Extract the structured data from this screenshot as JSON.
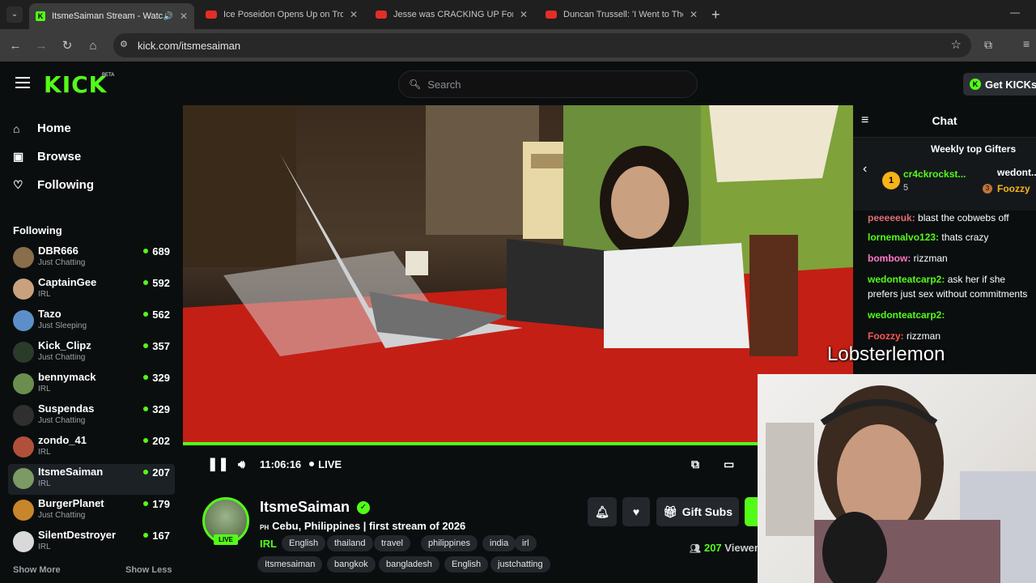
{
  "browser": {
    "tabs": [
      {
        "title": "ItsmeSaiman Stream - Watch",
        "active": true
      },
      {
        "title": "Ice Poseidon Opens Up on Trou",
        "active": false
      },
      {
        "title": "Jesse was CRACKING UP For RA",
        "active": false
      },
      {
        "title": "Duncan Trussell: 'I Went to The",
        "active": false
      }
    ],
    "new_tab": "+",
    "url": "kick.com/itsmesaiman",
    "minimize": "—"
  },
  "header": {
    "logo": "KICK",
    "beta": "BETA",
    "search_placeholder": "Search",
    "get_kicks": "Get KICKs"
  },
  "sidebar": {
    "nav": [
      {
        "label": "Home",
        "icon": "home-icon"
      },
      {
        "label": "Browse",
        "icon": "browse-icon"
      },
      {
        "label": "Following",
        "icon": "heart-icon"
      }
    ],
    "following_heading": "Following",
    "channels": [
      {
        "name": "DBR666",
        "category": "Just Chatting",
        "viewers": "689",
        "color": "#8a6d4a"
      },
      {
        "name": "CaptainGee",
        "category": "IRL",
        "viewers": "592",
        "color": "#c9a27d"
      },
      {
        "name": "Tazo",
        "category": "Just Sleeping",
        "viewers": "562",
        "color": "#5c8fc9"
      },
      {
        "name": "Kick_Clipz",
        "category": "Just Chatting",
        "viewers": "357",
        "color": "#2a3b2a"
      },
      {
        "name": "bennymack",
        "category": "IRL",
        "viewers": "329",
        "color": "#6a8e4f"
      },
      {
        "name": "Suspendas",
        "category": "Just Chatting",
        "viewers": "329",
        "color": "#2f2f2f"
      },
      {
        "name": "zondo_41",
        "category": "IRL",
        "viewers": "202",
        "color": "#b0503a"
      },
      {
        "name": "ItsmeSaiman",
        "category": "IRL",
        "viewers": "207",
        "color": "#7c9a63"
      },
      {
        "name": "BurgerPlanet",
        "category": "Just Chatting",
        "viewers": "179",
        "color": "#c8862a"
      },
      {
        "name": "SilentDestroyer",
        "category": "IRL",
        "viewers": "167",
        "color": "#d9d9d9"
      }
    ],
    "show_more": "Show More",
    "show_less": "Show Less"
  },
  "player": {
    "time": "11:06:16",
    "live": "LIVE"
  },
  "stream": {
    "name": "ItsmeSaiman",
    "live_badge": "LIVE",
    "country": "PH",
    "title": "Cebu, Philippines | first stream of 2026",
    "category": "IRL",
    "tags_row1": [
      "English",
      "thailand",
      "travel",
      "philippines",
      "india",
      "irl"
    ],
    "tags_row2": [
      "Itsmesaiman",
      "bangkok",
      "bangladesh",
      "English",
      "justchatting"
    ],
    "gift_subs": "Gift Subs",
    "viewers_count": "207",
    "viewers_label": "Viewer"
  },
  "chat": {
    "title": "Chat",
    "weekly_gifters": "Weekly top Gifters",
    "gifters": [
      {
        "rank": "1",
        "name": "cr4ckrockst...",
        "count": "5"
      },
      {
        "name": "wedont..."
      },
      {
        "rank": "3",
        "name": "Foozzy"
      }
    ],
    "messages": [
      {
        "user": "peeeeeuk:",
        "text": "blast the cobwebs off",
        "color": "#e06c75"
      },
      {
        "user": "lornemalvo123:",
        "text": "thats crazy",
        "color": "#53fc18"
      },
      {
        "user": "bombow:",
        "text": "rizzman",
        "color": "#ff79c6"
      },
      {
        "user": "wedonteatcarp2:",
        "text": "ask her if she",
        "color": "#53fc18"
      },
      {
        "user": "",
        "text": "prefers just sex without commitments",
        "color": "#fff"
      },
      {
        "user": "wedonteatcarp2:",
        "text": "",
        "color": "#53fc18"
      },
      {
        "user": "Foozzy:",
        "text": "rizzman",
        "color": "#ff5555"
      }
    ],
    "overlay_name": "Lobsterlemon"
  }
}
